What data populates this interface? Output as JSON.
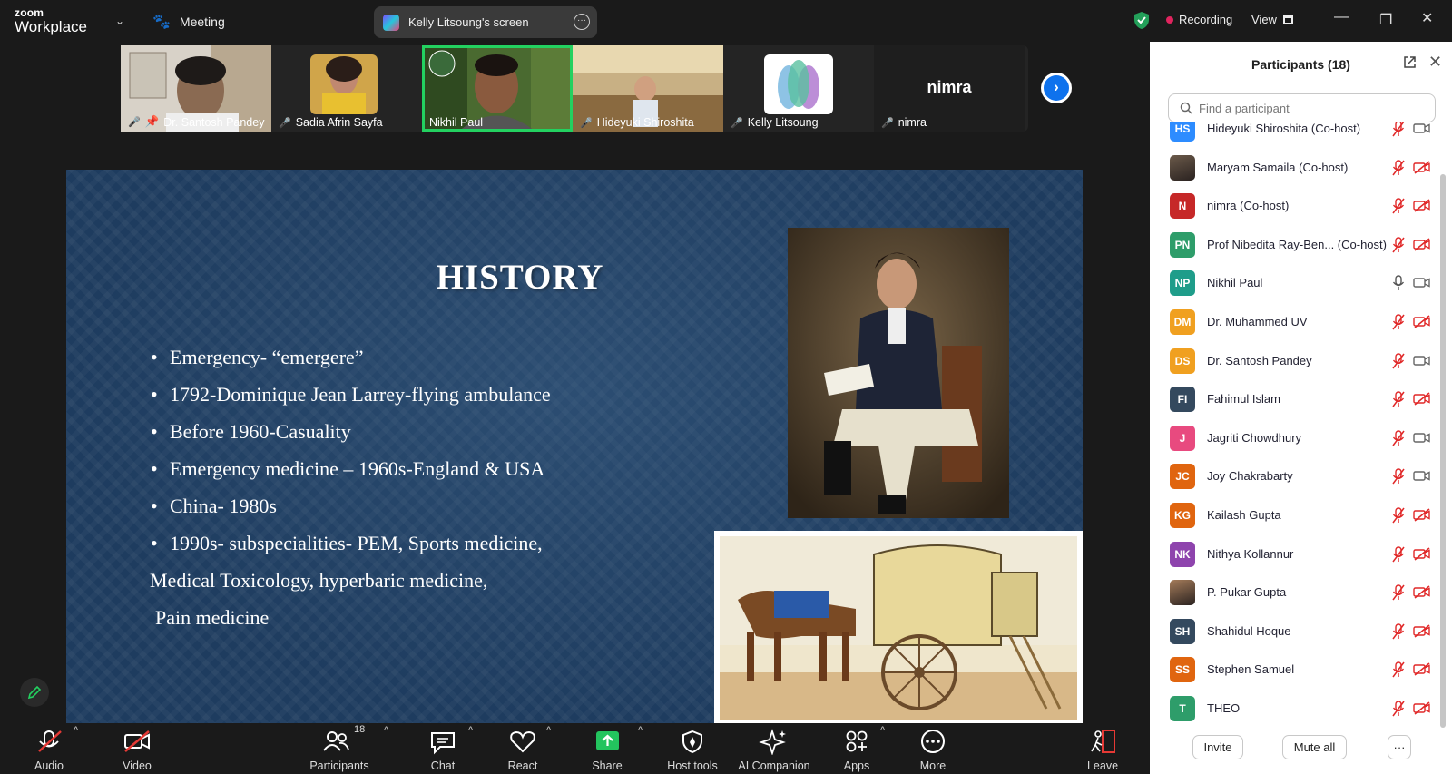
{
  "app": {
    "logo_top": "zoom",
    "logo_bottom": "Workplace",
    "meeting_label": "Meeting"
  },
  "screen_share": {
    "label": "Kelly Litsoung's screen"
  },
  "status": {
    "recording_label": "Recording",
    "view_label": "View"
  },
  "thumbnails": [
    {
      "name": "Dr. Santosh Pandey",
      "muted": true,
      "pinned": true,
      "bg": "#8a7868"
    },
    {
      "name": "Sadia Afrin Sayfa",
      "muted": true,
      "bg": "#1e1e1e"
    },
    {
      "name": "Nikhil Paul",
      "muted": false,
      "active": true,
      "bg": "#3d5a2a"
    },
    {
      "name": "Hideyuki Shiroshita",
      "muted": true,
      "bg": "#b8a070"
    },
    {
      "name": "Kelly Litsoung",
      "muted": true,
      "bg": "#1e1e1e"
    },
    {
      "name": "nimra",
      "muted": true,
      "bg": "#1e1e1e",
      "display_name": "nimra"
    }
  ],
  "slide": {
    "title": "HISTORY",
    "bullets": [
      "Emergency- “emergere”",
      "1792-Dominique Jean Larrey-flying ambulance",
      "Before 1960-Casuality",
      "Emergency medicine – 1960s-England & USA",
      "China- 1980s",
      "1990s- subspecialities- PEM, Sports medicine,"
    ],
    "continuation": [
      "Medical Toxicology, hyperbaric medicine,",
      "Pain medicine"
    ]
  },
  "toolbar": {
    "audio": "Audio",
    "video": "Video",
    "participants": "Participants",
    "participants_count": "18",
    "chat": "Chat",
    "react": "React",
    "share": "Share",
    "host_tools": "Host tools",
    "ai_companion": "AI Companion",
    "apps": "Apps",
    "more": "More",
    "leave": "Leave"
  },
  "panel": {
    "title": "Participants (18)",
    "search_placeholder": "Find a participant",
    "invite_label": "Invite",
    "mute_all_label": "Mute all",
    "more_label": "···",
    "participants": [
      {
        "initials": "HS",
        "name": "Hideyuki Shiroshita (Co-host)",
        "color": "#2d8cff",
        "mic": "muted",
        "cam": "on"
      },
      {
        "initials": "",
        "name": "Maryam Samaila (Co-host)",
        "color": "#6b5a4a",
        "photo": true,
        "mic": "muted",
        "cam": "off"
      },
      {
        "initials": "N",
        "name": "nimra (Co-host)",
        "color": "#c62828",
        "mic": "muted",
        "cam": "off"
      },
      {
        "initials": "PN",
        "name": "Prof Nibedita Ray-Ben...  (Co-host)",
        "color": "#2e9d6a",
        "mic": "muted",
        "cam": "off"
      },
      {
        "initials": "NP",
        "name": "Nikhil Paul",
        "color": "#1f9d8a",
        "mic": "on",
        "cam": "on"
      },
      {
        "initials": "DM",
        "name": "Dr. Muhammed UV",
        "color": "#f0a020",
        "mic": "muted",
        "cam": "off"
      },
      {
        "initials": "DS",
        "name": "Dr. Santosh Pandey",
        "color": "#f0a020",
        "mic": "muted",
        "cam": "on"
      },
      {
        "initials": "FI",
        "name": "Fahimul Islam",
        "color": "#34495e",
        "mic": "muted",
        "cam": "off"
      },
      {
        "initials": "J",
        "name": "Jagriti Chowdhury",
        "color": "#e84a7f",
        "mic": "muted",
        "cam": "on"
      },
      {
        "initials": "JC",
        "name": "Joy Chakrabarty",
        "color": "#e0650f",
        "mic": "muted",
        "cam": "on"
      },
      {
        "initials": "KG",
        "name": "Kailash Gupta",
        "color": "#e0650f",
        "mic": "muted",
        "cam": "off"
      },
      {
        "initials": "NK",
        "name": "Nithya Kollannur",
        "color": "#8e44ad",
        "mic": "muted",
        "cam": "off"
      },
      {
        "initials": "",
        "name": "P. Pukar Gupta",
        "color": "#a57c5a",
        "photo": true,
        "mic": "muted",
        "cam": "off"
      },
      {
        "initials": "SH",
        "name": "Shahidul Hoque",
        "color": "#34495e",
        "mic": "muted",
        "cam": "off"
      },
      {
        "initials": "SS",
        "name": "Stephen Samuel",
        "color": "#e0650f",
        "mic": "muted",
        "cam": "off"
      },
      {
        "initials": "T",
        "name": "THEO",
        "color": "#2e9d6a",
        "mic": "muted",
        "cam": "off"
      }
    ]
  }
}
